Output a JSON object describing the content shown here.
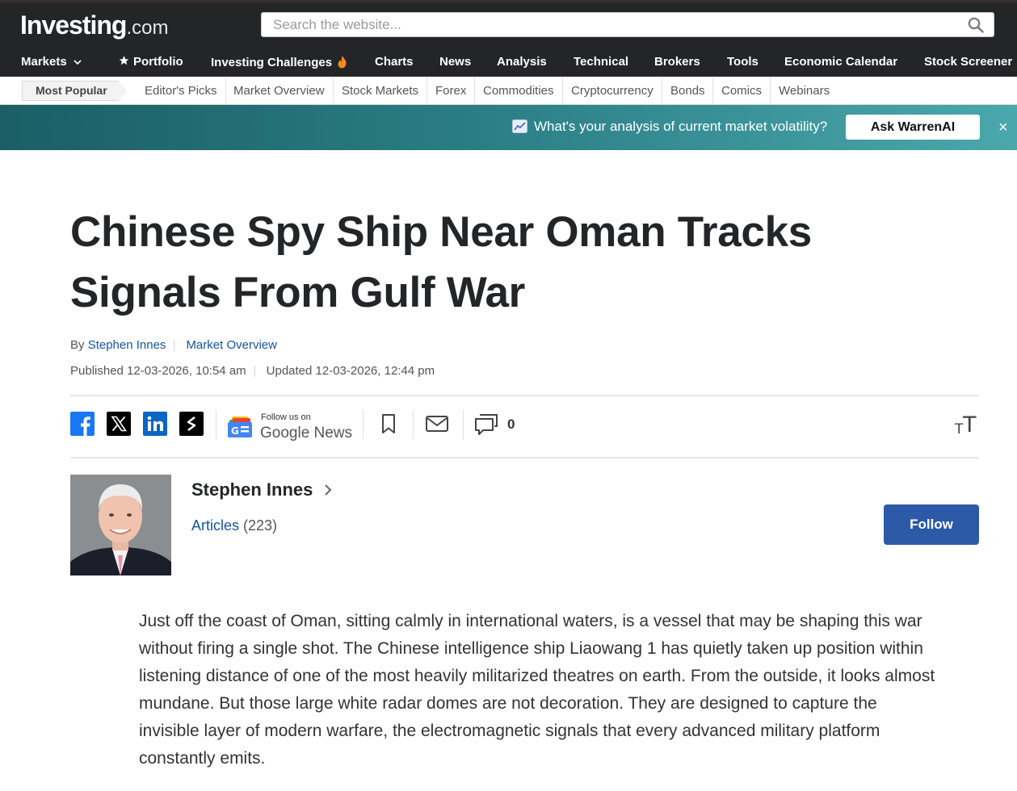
{
  "logo": {
    "brand": "Investing",
    "tld": ".com"
  },
  "search": {
    "placeholder": "Search the website..."
  },
  "main_nav": [
    {
      "label": "Markets"
    },
    {
      "label": "Portfolio"
    },
    {
      "label": "Investing Challenges"
    },
    {
      "label": "Charts"
    },
    {
      "label": "News"
    },
    {
      "label": "Analysis"
    },
    {
      "label": "Technical"
    },
    {
      "label": "Brokers"
    },
    {
      "label": "Tools"
    },
    {
      "label": "Economic Calendar"
    },
    {
      "label": "Stock Screener"
    }
  ],
  "sub_nav": {
    "active": "Most Popular",
    "items": [
      "Editor's Picks",
      "Market Overview",
      "Stock Markets",
      "Forex",
      "Commodities",
      "Cryptocurrency",
      "Bonds",
      "Comics",
      "Webinars"
    ]
  },
  "banner": {
    "text": "What's your analysis of current market volatility?",
    "button": "Ask WarrenAI",
    "close": "×",
    "icon": "chart-trend-icon"
  },
  "article": {
    "headline": "Chinese Spy Ship Near Oman Tracks Signals From Gulf War",
    "by_prefix": "By",
    "author": "Stephen Innes",
    "category": "Market Overview",
    "published": "Published 12-03-2026, 10:54 am",
    "updated": "Updated 12-03-2026, 12:44 pm",
    "body": "Just off the coast of Oman, sitting calmly in international waters, is a vessel that may be shaping this war without firing a single shot. The Chinese intelligence ship Liaowang 1 has quietly taken up position within listening distance of one of the most heavily militarized theatres on earth. From the outside, it looks almost mundane. But those large white radar domes are not decoration. They are designed to capture the invisible layer of modern warfare, the electromagnetic signals that every advanced military platform constantly emits."
  },
  "share_bar": {
    "google_news_small": "Follow us on",
    "google_news_big": "Google News",
    "comment_count": "0",
    "icons": [
      "facebook-icon",
      "x-icon",
      "linkedin-icon",
      "substack-icon",
      "bookmark-icon",
      "mail-icon",
      "comment-icon",
      "font-size-icon"
    ]
  },
  "author_card": {
    "name": "Stephen Innes",
    "articles_label": "Articles",
    "articles_count": "(223)",
    "follow_label": "Follow"
  },
  "colors": {
    "header_bg": "#232526",
    "link": "#1256a0",
    "follow_button": "#2c5aa6",
    "banner_start": "#1b5e66",
    "banner_end": "#4aa8ad"
  }
}
